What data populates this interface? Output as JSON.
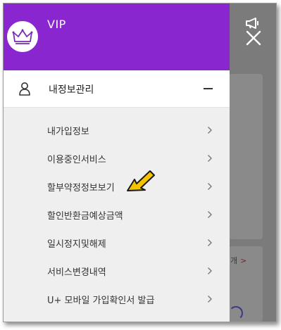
{
  "header": {
    "tier_label": "VIP",
    "avatar_icon": "crown-icon"
  },
  "menu": {
    "section_title": "내정보관리",
    "section_icon": "person-icon",
    "collapse_symbol": "minus-icon",
    "items": [
      {
        "label": "내가입정보"
      },
      {
        "label": "이용중인서비스"
      },
      {
        "label": "할부약정정보보기"
      },
      {
        "label": "할인반환금예상금액"
      },
      {
        "label": "일시정지및해제"
      },
      {
        "label": "서비스변경내역"
      },
      {
        "label": "U+ 모바일 가입확인서 발급"
      }
    ]
  },
  "background": {
    "more_label": "개",
    "notice_icon": "megaphone-icon",
    "close_icon": "close-icon"
  },
  "colors": {
    "accent": "#8a26cf",
    "pointer_arrow": "#f5c400"
  }
}
